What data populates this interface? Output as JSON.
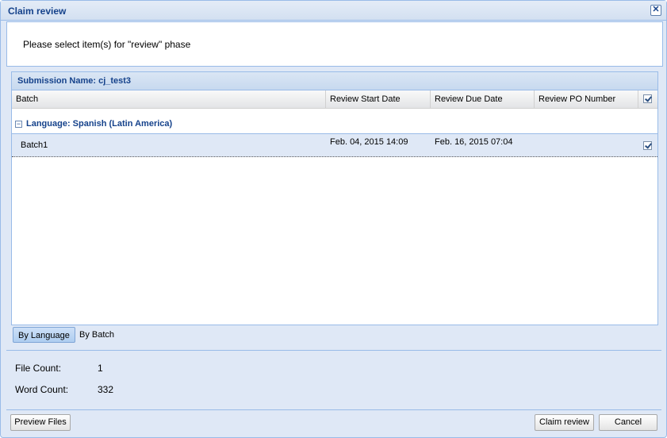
{
  "window": {
    "title": "Claim review",
    "close_symbol": "✕"
  },
  "intro": {
    "text": "Please select item(s) for \"review\" phase"
  },
  "grid": {
    "title": "Submission Name: cj_test3",
    "columns": [
      "Batch",
      "Review Start Date",
      "Review Due Date",
      "Review PO Number"
    ],
    "header_checked": true,
    "group": {
      "toggle": "−",
      "label": "Language: Spanish (Latin America)"
    },
    "rows": [
      {
        "batch": "Batch1",
        "start_date": "Feb. 04, 2015 14:09",
        "due_date": "Feb. 16, 2015 07:04",
        "po_number": "",
        "checked": true
      }
    ]
  },
  "tabs": [
    {
      "label": "By Language",
      "active": true
    },
    {
      "label": "By Batch",
      "active": false
    }
  ],
  "stats": {
    "file_count_label": "File Count:",
    "file_count_value": "1",
    "word_count_label": "Word Count:",
    "word_count_value": "332"
  },
  "buttons": {
    "preview": "Preview Files",
    "claim": "Claim review",
    "cancel": "Cancel"
  }
}
